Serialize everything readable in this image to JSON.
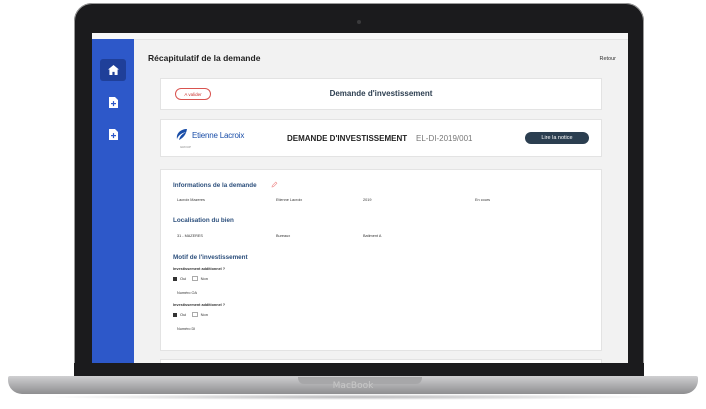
{
  "device": {
    "brand": "MacBook"
  },
  "sidebar": {
    "items": [
      {
        "icon": "home-icon"
      },
      {
        "icon": "document-add-icon"
      },
      {
        "icon": "document-add-icon"
      }
    ]
  },
  "header": {
    "title": "Récapitulatif de la demande",
    "back": "Retour"
  },
  "status_card": {
    "badge": "A valider",
    "title": "Demande d'investissement"
  },
  "doc_card": {
    "logo": "Etienne Lacroix",
    "logo_sub": "GROUP",
    "title": "DEMANDE D'INVESTISSEMENT",
    "reference": "EL-DI-2019/001",
    "notice_button": "Lire la notice"
  },
  "details": {
    "info_title": "Informations de la demande",
    "info_values": [
      "Lacroix Mazeres",
      "Etienne Lacroix",
      "2019",
      "En cours"
    ],
    "location_title": "Localisation du bien",
    "location_values": [
      "31 - MAZERES",
      "Bureaux",
      "Batiment A"
    ],
    "motive_title": "Motif de l'investissement",
    "question1": "Investissement additionnel ?",
    "question2": "Investissement additionnel ?",
    "oui": "Oui",
    "non": "Non",
    "numero_oa": "Numéro OA",
    "numero_di": "Numéro DI"
  },
  "colors": {
    "sidebar": "#2d58c9",
    "badge": "#d9534f",
    "notice_button": "#2b3e50",
    "section_title": "#2c4f7c"
  }
}
